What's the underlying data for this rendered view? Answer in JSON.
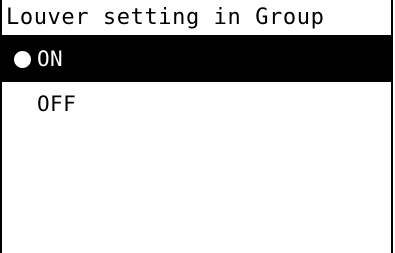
{
  "screen": {
    "title": "Louver setting in Group"
  },
  "options": [
    {
      "label": "ON",
      "selected": true
    },
    {
      "label": "OFF",
      "selected": false
    }
  ],
  "colors": {
    "background": "#ffffff",
    "foreground": "#000000",
    "highlight": "#000000",
    "highlight_text": "#ffffff"
  },
  "icons": {
    "selection_marker": "filled-circle-icon"
  }
}
